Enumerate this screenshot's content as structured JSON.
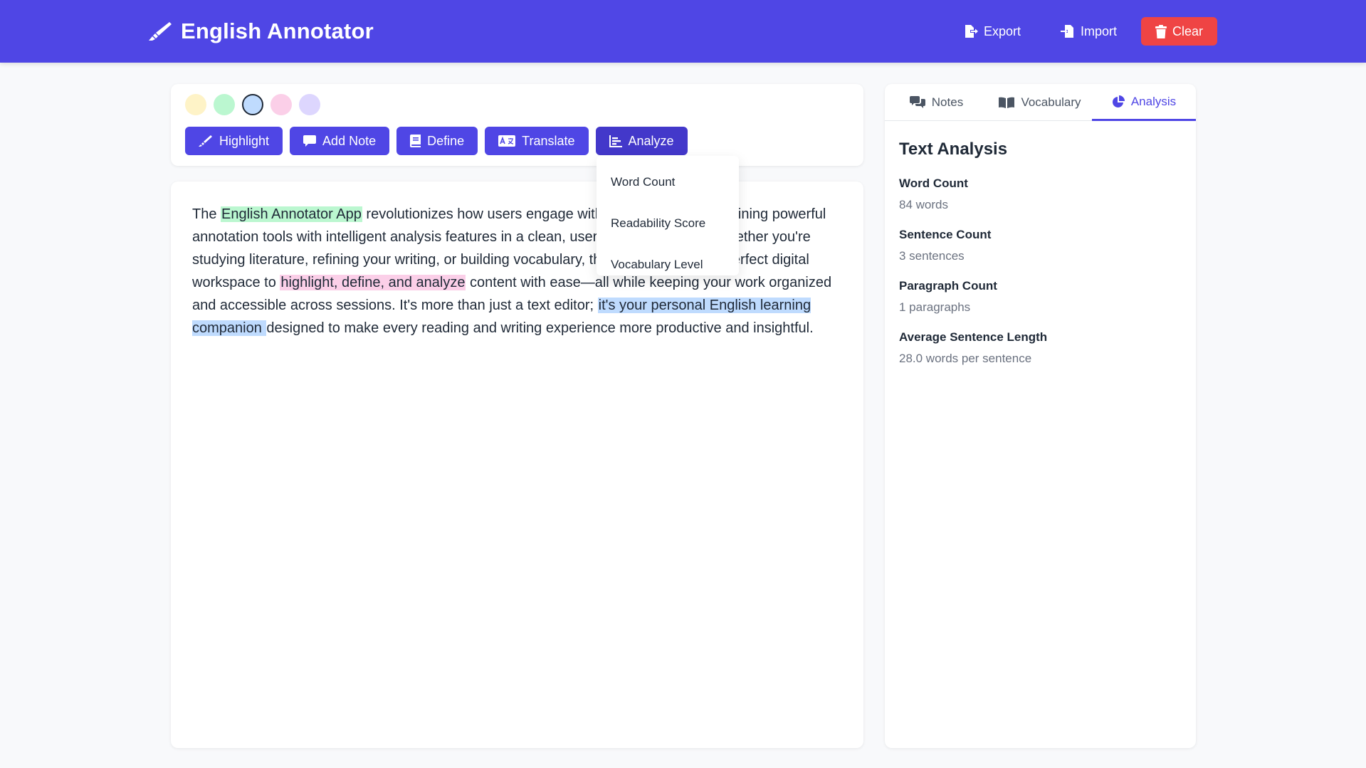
{
  "header": {
    "title": "English Annotator",
    "export_label": "Export",
    "import_label": "Import",
    "clear_label": "Clear"
  },
  "colors": {
    "header_bg": "#4f46e5",
    "clear_bg": "#ef4444",
    "swatches": [
      "#fef3c7",
      "#bbf7d0",
      "#bfdbfe",
      "#fbcfe8",
      "#ddd6fe"
    ]
  },
  "toolbar": {
    "highlight_label": "Highlight",
    "add_note_label": "Add Note",
    "define_label": "Define",
    "translate_label": "Translate",
    "analyze_label": "Analyze"
  },
  "analyze_menu": {
    "items": [
      "Word Count",
      "Readability Score",
      "Vocabulary Level"
    ]
  },
  "editor": {
    "p1": "The ",
    "h1": "English Annotator App",
    "p2": " revolutionizes how users engage with English text by combining powerful annotation tools with intelligent analysis features in a clean, user-friendly interface. Whether you're studying literature, refining your writing, or building vocabulary, this app provides the perfect digital workspace to ",
    "h2": "highlight, define, and analyze",
    "p3": " content with ease—all while keeping your work organized and accessible across sessions. It's more than just a text editor; ",
    "h3": "it's your personal English learning companion ",
    "p4": "designed to make every reading and writing experience more productive and insightful."
  },
  "sidebar": {
    "tabs": [
      "Notes",
      "Vocabulary",
      "Analysis"
    ],
    "active_tab": "Analysis",
    "title": "Text Analysis",
    "stats": [
      {
        "label": "Word Count",
        "value": "84 words"
      },
      {
        "label": "Sentence Count",
        "value": "3 sentences"
      },
      {
        "label": "Paragraph Count",
        "value": "1 paragraphs"
      },
      {
        "label": "Average Sentence Length",
        "value": "28.0 words per sentence"
      }
    ]
  }
}
